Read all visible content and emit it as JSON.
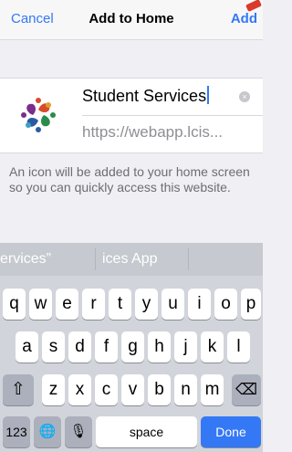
{
  "nav": {
    "cancel": "Cancel",
    "title": "Add to Home",
    "add": "Add"
  },
  "form": {
    "name_value": "Student Services",
    "url_value": "https://webapp.lcis...",
    "clear_icon": "×",
    "info": "An icon will be added to your home screen so you can quickly access this website."
  },
  "keyboard": {
    "suggestions": [
      "ervices”",
      "ices App"
    ],
    "row1": [
      "q",
      "w",
      "e",
      "r",
      "t",
      "y",
      "u",
      "i",
      "o",
      "p"
    ],
    "row2": [
      "a",
      "s",
      "d",
      "f",
      "g",
      "h",
      "j",
      "k",
      "l"
    ],
    "row3": [
      "z",
      "x",
      "c",
      "v",
      "b",
      "n",
      "m"
    ],
    "shift": "⇧",
    "backspace": "⌫",
    "numbers": "123",
    "globe": "🌐",
    "mic": "🎙",
    "space": "space",
    "done": "Done"
  },
  "colors": {
    "accent": "#3478f6",
    "keyboard_bg": "#d1d4da"
  }
}
